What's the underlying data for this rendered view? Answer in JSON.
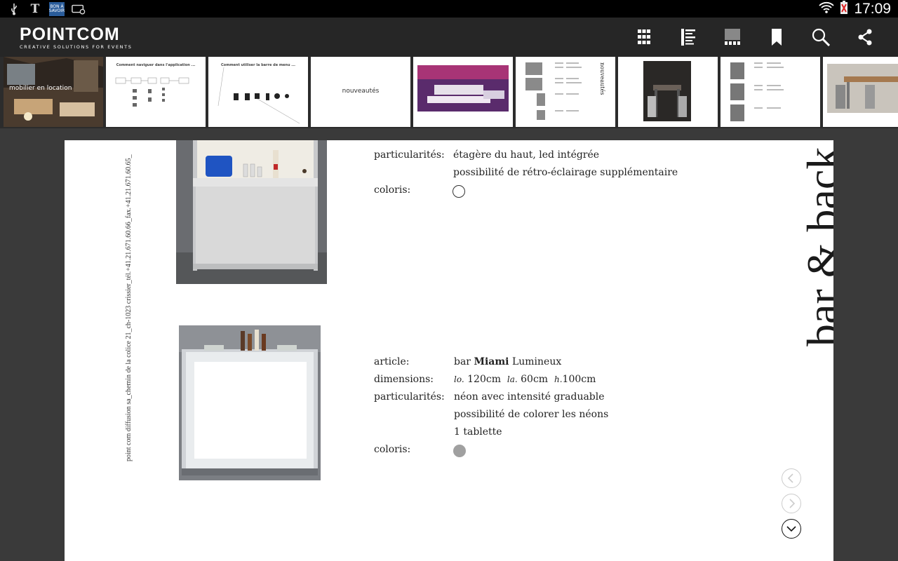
{
  "status_bar": {
    "time": "17:09",
    "notification_icons": [
      "usb-icon",
      "nytimes-icon",
      "bon-a-savoir-icon",
      "voicemail-icon"
    ],
    "bon_a_savoir_text": "BON À SAVOIR"
  },
  "app": {
    "logo_main": "POINTCOM",
    "logo_sub": "CREATIVE SOLUTIONS FOR EVENTS",
    "toolbar_icons": [
      "grid-view-icon",
      "list-view-icon",
      "thumbnails-icon",
      "bookmark-icon",
      "search-icon",
      "share-icon"
    ]
  },
  "thumbnails": [
    {
      "title": "mobilier en location"
    },
    {
      "title": "Comment naviguer dans l'application ..."
    },
    {
      "title": "Comment utiliser la barre de menu ..."
    },
    {
      "title": "nouveautés"
    },
    {
      "title": ""
    },
    {
      "title": "nouveautés"
    },
    {
      "title": ""
    },
    {
      "title": ""
    },
    {
      "title": ""
    }
  ],
  "page": {
    "side_address": "point com diffusion sa_chemin de la colice 21_ch-1023 crissier_tél.+41.21.671.60.66_fax.+41.21.671.60.65_",
    "section_title": "bar & back",
    "product1": {
      "label_particularites": "particularités:",
      "particularites_1": "étagère du haut, led intégrée",
      "particularites_2": "possibilité de rétro-éclairage supplémentaire",
      "label_coloris": "coloris:",
      "coloris_color": "#ffffff"
    },
    "product2": {
      "label_article": "article:",
      "article_prefix": "bar",
      "article_bold": "Miami",
      "article_suffix": "Lumineux",
      "label_dimensions": "dimensions:",
      "dim_lo_label": "lo.",
      "dim_lo": "120cm",
      "dim_la_label": "la.",
      "dim_la": "60cm",
      "dim_h_label": "h.",
      "dim_h": "100cm",
      "label_particularites": "particularités:",
      "particularites_1": "néon avec intensité graduable",
      "particularites_2": "possibilité de colorer les néons",
      "particularites_3": "1 tablette",
      "label_coloris": "coloris:",
      "coloris_color": "#a0a0a0"
    },
    "nav_icons": [
      "previous-page-icon",
      "next-page-icon",
      "scroll-down-icon"
    ]
  }
}
